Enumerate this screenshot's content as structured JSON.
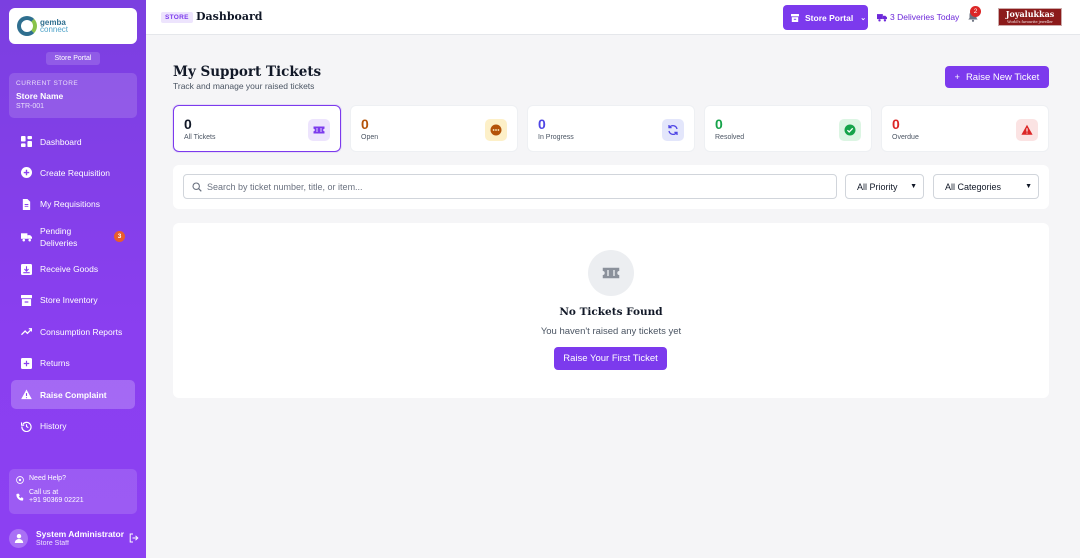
{
  "sidebar": {
    "logo": {
      "line1": "gemba",
      "line2": "connect"
    },
    "portal_label": "Store Portal",
    "store": {
      "caption": "CURRENT STORE",
      "name": "Store Name",
      "code": "STR-001"
    },
    "items": [
      {
        "label": "Dashboard",
        "icon": "dashboard-icon"
      },
      {
        "label": "Create Requisition",
        "icon": "plus-circle-icon"
      },
      {
        "label": "My Requisitions",
        "icon": "document-icon"
      },
      {
        "label": "Pending Deliveries",
        "icon": "truck-icon",
        "badge": "3"
      },
      {
        "label": "Receive Goods",
        "icon": "inbox-download-icon"
      },
      {
        "label": "Store Inventory",
        "icon": "store-icon"
      },
      {
        "label": "Consumption Reports",
        "icon": "trend-icon"
      },
      {
        "label": "Returns",
        "icon": "return-box-icon"
      },
      {
        "label": "Raise Complaint",
        "icon": "warning-icon",
        "active": true
      },
      {
        "label": "History",
        "icon": "history-icon"
      }
    ],
    "help": {
      "title": "Need Help?",
      "call_label": "Call us at",
      "phone": "+91 90369 02221"
    },
    "user": {
      "name": "System Administrator",
      "role": "Store Staff"
    }
  },
  "header": {
    "tag": "STORE",
    "title": "Dashboard",
    "portal_button": "Store Portal",
    "deliveries_today": "3 Deliveries Today",
    "notification_count": "2",
    "brand": {
      "name": "Joyalukkas",
      "tagline": "World's favourite jeweller"
    }
  },
  "page": {
    "title": "My Support Tickets",
    "subtitle": "Track and manage your raised tickets",
    "raise_button": "Raise New Ticket",
    "raise_button_icon": "+"
  },
  "stats": [
    {
      "value": "0",
      "label": "All Tickets",
      "color": "#111827",
      "icon": "ticket-icon",
      "icon_bg": "#ede4fd",
      "icon_color": "#7c3aed"
    },
    {
      "value": "0",
      "label": "Open",
      "color": "#b45309",
      "icon": "dots-circle-icon",
      "icon_bg": "#fdf0c8",
      "icon_color": "#b45309"
    },
    {
      "value": "0",
      "label": "In Progress",
      "color": "#4f46e5",
      "icon": "refresh-icon",
      "icon_bg": "#e3e6fb",
      "icon_color": "#4f46e5"
    },
    {
      "value": "0",
      "label": "Resolved",
      "color": "#16a34a",
      "icon": "check-circle-icon",
      "icon_bg": "#dcf5e3",
      "icon_color": "#16a34a"
    },
    {
      "value": "0",
      "label": "Overdue",
      "color": "#dc2626",
      "icon": "alert-triangle-icon",
      "icon_bg": "#fbe3e3",
      "icon_color": "#dc2626"
    }
  ],
  "filters": {
    "search_placeholder": "Search by ticket number, title, or item...",
    "priority": "All Priority",
    "category": "All Categories"
  },
  "empty": {
    "title": "No Tickets Found",
    "subtitle": "You haven't raised any tickets yet",
    "button": "Raise Your First Ticket"
  }
}
